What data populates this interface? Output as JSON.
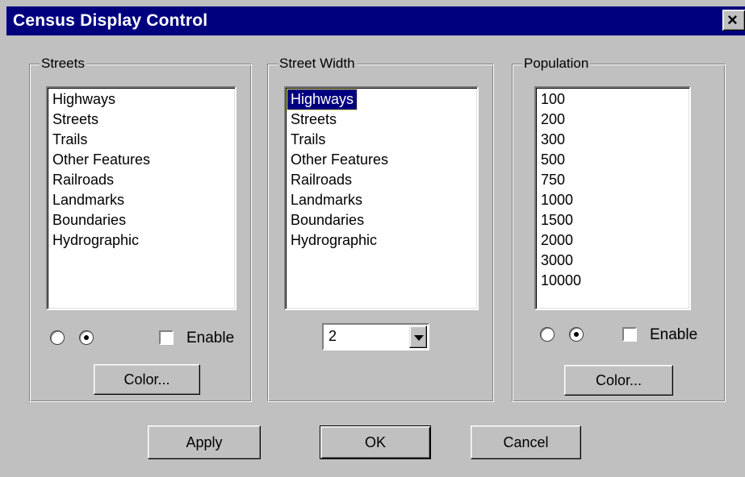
{
  "window": {
    "title": "Census Display Control",
    "close_glyph": "×"
  },
  "streets": {
    "label": "Streets",
    "items": [
      "Highways",
      "Streets",
      "Trails",
      "Other Features",
      "Railroads",
      "Landmarks",
      "Boundaries",
      "Hydrographic"
    ],
    "radio_selected": 1,
    "enable_label": "Enable",
    "enable_checked": false,
    "color_button": "Color..."
  },
  "street_width": {
    "label": "Street Width",
    "items": [
      "Highways",
      "Streets",
      "Trails",
      "Other Features",
      "Railroads",
      "Landmarks",
      "Boundaries",
      "Hydrographic"
    ],
    "selected_index": 0,
    "width_value": "2"
  },
  "population": {
    "label": "Population",
    "items": [
      "100",
      "200",
      "300",
      "500",
      "750",
      "1000",
      "1500",
      "2000",
      "3000",
      "10000"
    ],
    "radio_selected": 1,
    "enable_label": "Enable",
    "enable_checked": false,
    "color_button": "Color..."
  },
  "footer": {
    "apply": "Apply",
    "ok": "OK",
    "cancel": "Cancel"
  }
}
